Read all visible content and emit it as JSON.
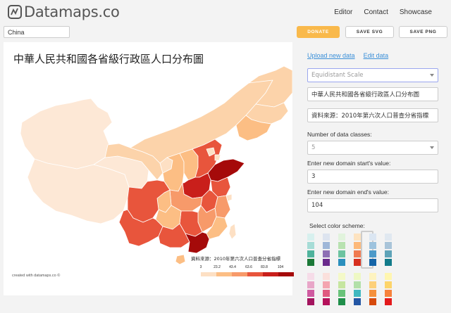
{
  "header": {
    "brand": "Datamaps.co",
    "nav": [
      "Editor",
      "Contact",
      "Showcase"
    ]
  },
  "toolbar": {
    "country_value": "China",
    "donate_label": "DONATE",
    "save_svg_label": "SAVE SVG",
    "save_png_label": "SAVE PNG"
  },
  "map": {
    "title": "中華人民共和國各省級行政區人口分布圖",
    "source": "資料來源：2010年第六次人口普查分省指標",
    "legend_ticks": [
      "3",
      "23.2",
      "43.4",
      "63.6",
      "83.8",
      "104"
    ],
    "legend_colors": [
      "#fde0c4",
      "#fcbe84",
      "#f79a6a",
      "#e8553c",
      "#c91f1b",
      "#a50a0a"
    ],
    "credit": "created with datamaps.co ©"
  },
  "panel": {
    "upload_link": "Upload new data",
    "edit_link": "Edit data",
    "scale_select": "Equidistant Scale",
    "title_value": "中華人民共和國各省級行政區人口分布圖",
    "source_value": "資料來源：2010年第六次人口普查分省指標",
    "classes_label": "Number of data classes:",
    "classes_value": "5",
    "start_label": "Enter new domain start's value:",
    "start_value": "3",
    "end_label": "Enter new domain end's value:",
    "end_value": "104",
    "color_label": "Select color scheme:"
  },
  "color_schemes_row1": [
    [
      "#d7f0ee",
      "#a6dcd6",
      "#4fb39c",
      "#1b7837"
    ],
    [
      "#dde4ef",
      "#9fb7d8",
      "#8e6fb4",
      "#6a2a8c"
    ],
    [
      "#e1f3dc",
      "#b8e2b0",
      "#6cc3a0",
      "#2b8fbd"
    ],
    [
      "#fde3c0",
      "#fdb97a",
      "#f07a50",
      "#d7301f"
    ],
    [
      "#dbe6f2",
      "#9ec3de",
      "#4d9ac9",
      "#1565a8"
    ],
    [
      "#e0e8f0",
      "#a9c4d9",
      "#5ea3b8",
      "#127b8a"
    ]
  ],
  "color_schemes_row2": [
    [
      "#f6dce8",
      "#e8a6c8",
      "#cf5aa0",
      "#a3145e"
    ],
    [
      "#fbe0dc",
      "#f4a5b0",
      "#e05a80",
      "#b5115a"
    ],
    [
      "#f4f9c8",
      "#c6e6a0",
      "#69c37a",
      "#1f8e4a"
    ],
    [
      "#eef8c4",
      "#b2e0a8",
      "#40b8c0",
      "#2456a4"
    ],
    [
      "#fef3c0",
      "#fdd07a",
      "#f5903c",
      "#d64a0c"
    ],
    [
      "#fff6b0",
      "#fdd46a",
      "#f7823c",
      "#e31a1c"
    ]
  ]
}
